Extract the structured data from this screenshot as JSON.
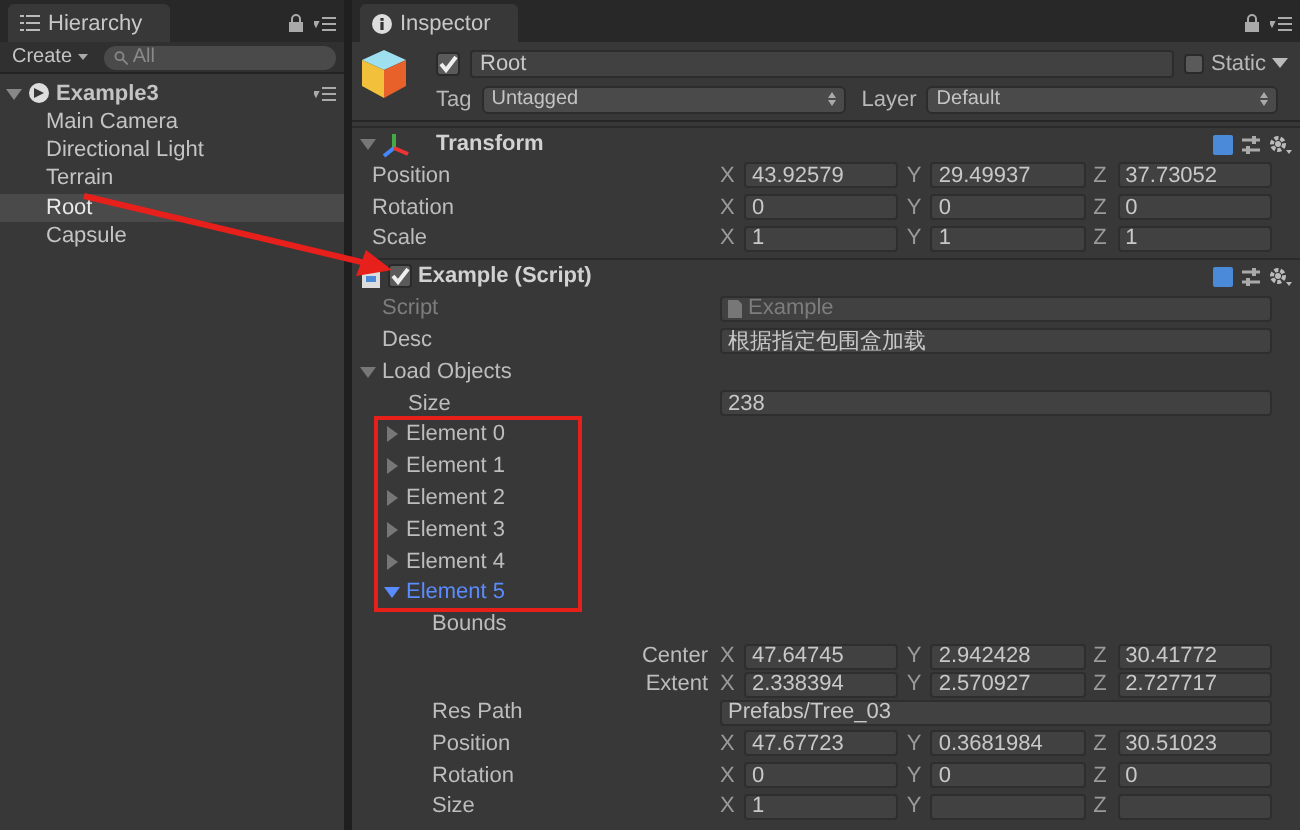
{
  "hierarchy": {
    "tab": "Hierarchy",
    "create": "Create",
    "search": {
      "placeholder": "All"
    },
    "scene": {
      "name": "Example3",
      "expanded": true
    },
    "items": [
      {
        "label": "Main Camera",
        "selected": false
      },
      {
        "label": "Directional Light",
        "selected": false
      },
      {
        "label": "Terrain",
        "selected": false
      },
      {
        "label": "Root",
        "selected": true
      },
      {
        "label": "Capsule",
        "selected": false
      }
    ]
  },
  "inspector": {
    "tab": "Inspector",
    "object": {
      "active": true,
      "name": "Root",
      "static": false,
      "static_label": "Static",
      "tag_label": "Tag",
      "tag": "Untagged",
      "layer_label": "Layer",
      "layer": "Default"
    },
    "transform": {
      "title": "Transform",
      "expanded": true,
      "rows": [
        {
          "label": "Position",
          "values": [
            {
              "axis": "X",
              "value": "43.92579"
            },
            {
              "axis": "Y",
              "value": "29.49937"
            },
            {
              "axis": "Z",
              "value": "37.73052"
            }
          ]
        },
        {
          "label": "Rotation",
          "values": [
            {
              "axis": "X",
              "value": "0"
            },
            {
              "axis": "Y",
              "value": "0"
            },
            {
              "axis": "Z",
              "value": "0"
            }
          ]
        },
        {
          "label": "Scale",
          "values": [
            {
              "axis": "X",
              "value": "1"
            },
            {
              "axis": "Y",
              "value": "1"
            },
            {
              "axis": "Z",
              "value": "1"
            }
          ]
        }
      ]
    },
    "script": {
      "title": "Example (Script)",
      "enabled": true,
      "script_label": "Script",
      "script_value": "Example",
      "desc_label": "Desc",
      "desc": "根据指定包围盒加载",
      "list": {
        "label": "Load Objects",
        "expanded": true,
        "size_label": "Size",
        "size": "238",
        "elements": [
          {
            "label": "Element 0",
            "expanded": false,
            "selected": false
          },
          {
            "label": "Element 1",
            "expanded": false,
            "selected": false
          },
          {
            "label": "Element 2",
            "expanded": false,
            "selected": false
          },
          {
            "label": "Element 3",
            "expanded": false,
            "selected": false
          },
          {
            "label": "Element 4",
            "expanded": false,
            "selected": false
          },
          {
            "label": "Element 5",
            "expanded": true,
            "selected": true,
            "bounds": {
              "label": "Bounds",
              "rows": [
                {
                  "label": "Center",
                  "values": [
                    {
                      "axis": "X",
                      "value": "47.64745"
                    },
                    {
                      "axis": "Y",
                      "value": "2.942428"
                    },
                    {
                      "axis": "Z",
                      "value": "30.41772"
                    }
                  ]
                },
                {
                  "label": "Extent",
                  "values": [
                    {
                      "axis": "X",
                      "value": "2.338394"
                    },
                    {
                      "axis": "Y",
                      "value": "2.570927"
                    },
                    {
                      "axis": "Z",
                      "value": "2.727717"
                    }
                  ]
                }
              ]
            },
            "res_path_label": "Res Path",
            "res_path": "Prefabs/Tree_03",
            "rows": [
              {
                "label": "Position",
                "values": [
                  {
                    "axis": "X",
                    "value": "47.67723"
                  },
                  {
                    "axis": "Y",
                    "value": "0.3681984"
                  },
                  {
                    "axis": "Z",
                    "value": "30.51023"
                  }
                ]
              },
              {
                "label": "Rotation",
                "values": [
                  {
                    "axis": "X",
                    "value": "0"
                  },
                  {
                    "axis": "Y",
                    "value": "0"
                  },
                  {
                    "axis": "Z",
                    "value": "0"
                  }
                ]
              },
              {
                "label": "Size",
                "values": [
                  {
                    "axis": "X",
                    "value": "1"
                  },
                  {
                    "axis": "Y"
                  },
                  {
                    "axis": "Z"
                  }
                ]
              }
            ]
          }
        ]
      }
    }
  }
}
